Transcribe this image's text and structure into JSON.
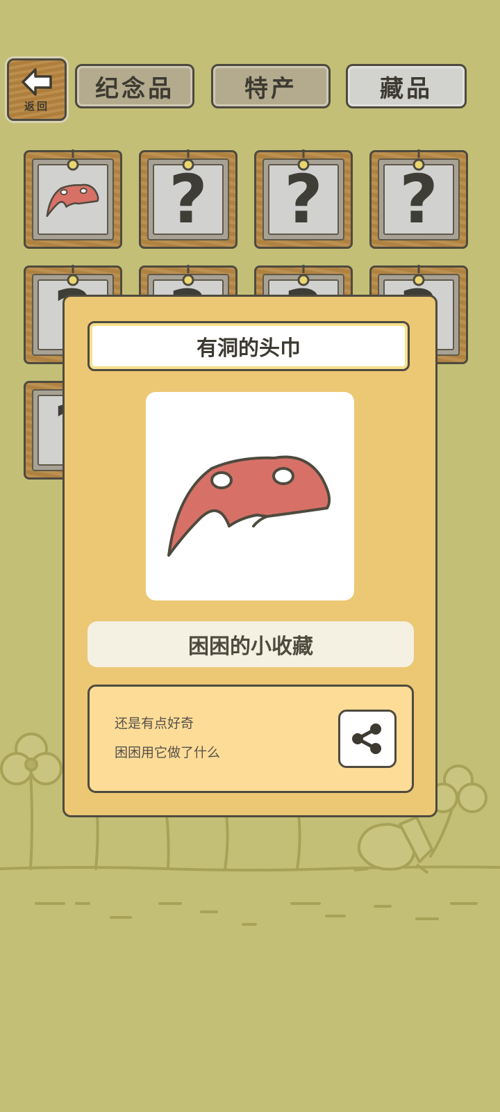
{
  "back": {
    "label": "返回",
    "icon": "arrow-left-icon"
  },
  "tabs": [
    {
      "label": "纪念品",
      "active": false
    },
    {
      "label": "特产",
      "active": false
    },
    {
      "label": "藏品",
      "active": true
    }
  ],
  "grid": {
    "items": [
      {
        "state": "unlocked",
        "icon": "headscarf-icon"
      },
      {
        "state": "locked",
        "glyph": "?"
      },
      {
        "state": "locked",
        "glyph": "?"
      },
      {
        "state": "locked",
        "glyph": "?"
      },
      {
        "state": "locked",
        "glyph": "?"
      },
      {
        "state": "locked",
        "glyph": "?"
      },
      {
        "state": "locked",
        "glyph": "?"
      },
      {
        "state": "locked",
        "glyph": "?"
      },
      {
        "state": "locked",
        "glyph": "?"
      }
    ]
  },
  "dialog": {
    "title": "有洞的头巾",
    "image_icon": "headscarf-icon",
    "category": "困困的小收藏",
    "description": [
      "还是有点好奇",
      "困困用它做了什么"
    ],
    "share_icon": "share-icon"
  },
  "colors": {
    "background": "#c3bf77",
    "wood": "#b88945",
    "dialog": "#ecc774",
    "scarf": "#d77168",
    "outline": "#4e4a3e"
  }
}
